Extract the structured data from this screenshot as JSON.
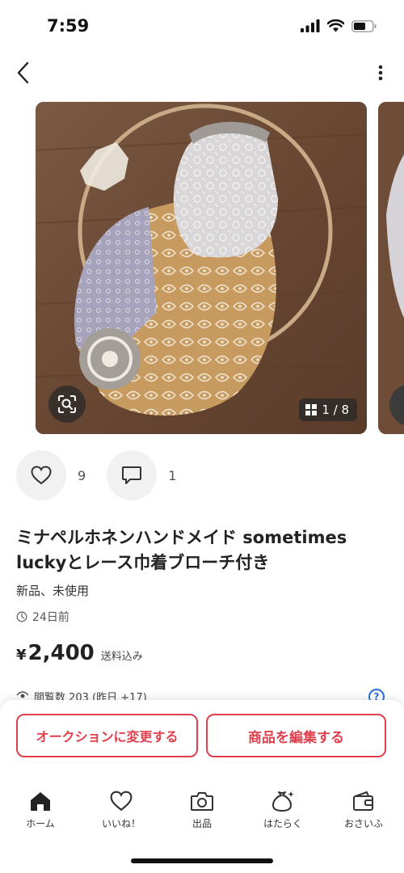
{
  "status_bar": {
    "time": "7:59"
  },
  "product": {
    "image_counter": "1 / 8",
    "likes_count": "9",
    "comments_count": "1",
    "title": "ミナペルホネンハンドメイド sometimes luckyとレース巾着ブローチ付き",
    "condition": "新品、未使用",
    "posted": "24日前",
    "price_symbol": "¥",
    "price_amount": "2,400",
    "shipping": "送料込み",
    "views": "閲覧数 203 (昨日 +17)"
  },
  "actions": {
    "auction_label": "オークションに変更する",
    "edit_label": "商品を編集する"
  },
  "tabbar": {
    "items": [
      {
        "label": "ホーム",
        "icon": "home-icon",
        "active": true
      },
      {
        "label": "いいね！",
        "icon": "heart-icon"
      },
      {
        "label": "出品",
        "icon": "camera-icon"
      },
      {
        "label": "はたらく",
        "icon": "money-bag-icon"
      },
      {
        "label": "おさいふ",
        "icon": "wallet-icon"
      }
    ]
  },
  "colors": {
    "accent": "#e0404d",
    "help": "#2a6fdb"
  }
}
